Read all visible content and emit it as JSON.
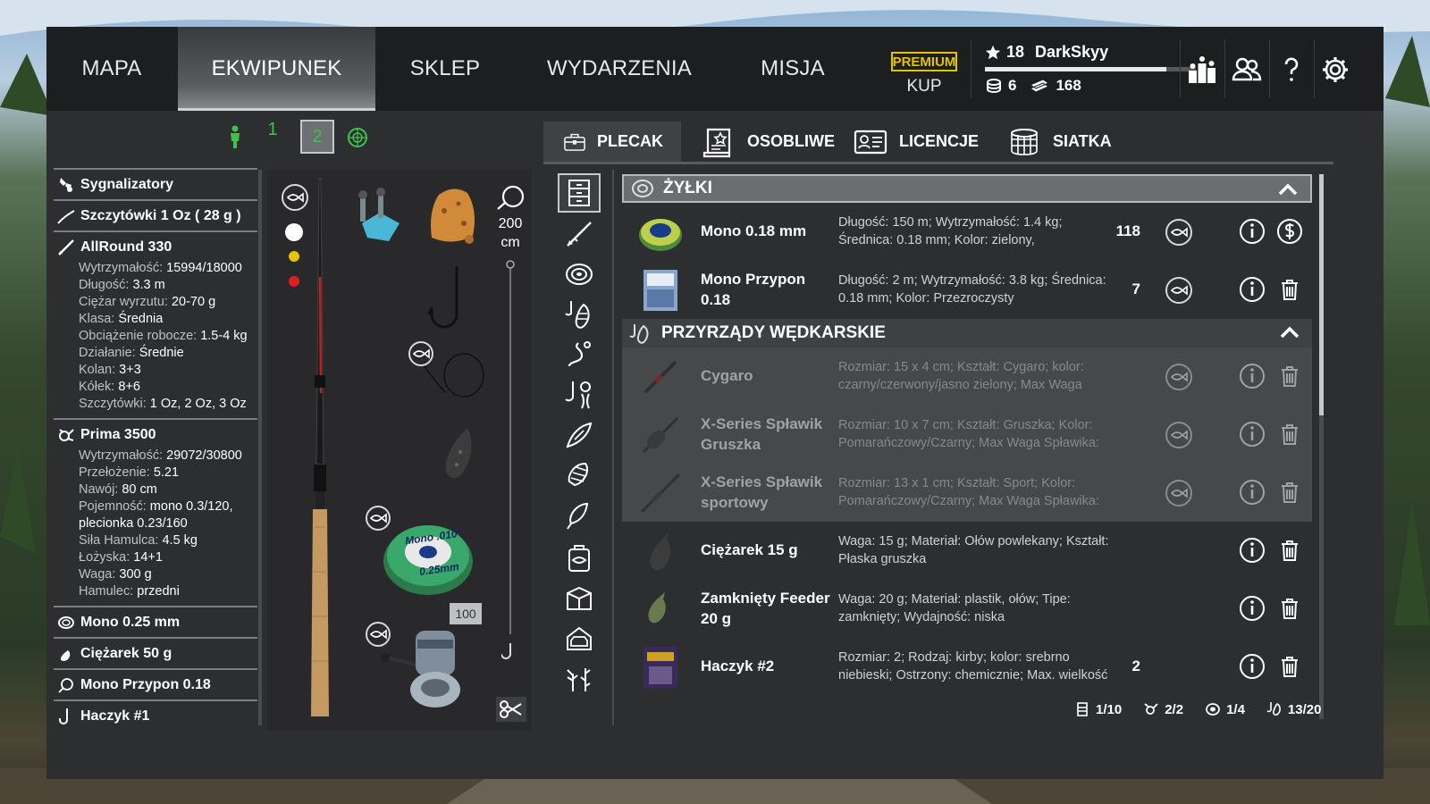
{
  "nav": {
    "tabs": [
      {
        "label": "MAPA"
      },
      {
        "label": "EKWIPUNEK"
      },
      {
        "label": "SKLEP"
      },
      {
        "label": "WYDARZENIA"
      },
      {
        "label": "MISJA"
      }
    ],
    "active": "EKWIPUNEK"
  },
  "premium": {
    "badge": "PREMIUM",
    "buy": "KUP"
  },
  "player": {
    "level": "18",
    "name": "DarkSkyy",
    "xp_fraction": 0.86,
    "coins": "6",
    "bills": "168"
  },
  "presets": {
    "p1": "1",
    "p2": "2"
  },
  "left": {
    "sygnalizatory": "Sygnalizatory",
    "szczytowki": "Szczytówki 1 Oz ( 28 g )",
    "rod": {
      "name": "AllRound 330",
      "stats": [
        {
          "label": "Wytrzymałość:",
          "value": "15994/18000"
        },
        {
          "label": "Długość:",
          "value": "3.3 m"
        },
        {
          "label": "Ciężar wyrzutu:",
          "value": "20-70 g"
        },
        {
          "label": "Klasa:",
          "value": "Średnia"
        },
        {
          "label": "Obciążenie robocze:",
          "value": "1.5-4 kg"
        },
        {
          "label": "Działanie:",
          "value": "Średnie"
        },
        {
          "label": "Kolan:",
          "value": "3+3"
        },
        {
          "label": "Kółek:",
          "value": "8+6"
        },
        {
          "label": "Szczytówki:",
          "value": "1 Oz, 2 Oz, 3 Oz"
        }
      ]
    },
    "reel": {
      "name": "Prima 3500",
      "stats": [
        {
          "label": "Wytrzymałość:",
          "value": "29072/30800"
        },
        {
          "label": "Przełożenie:",
          "value": "5.21"
        },
        {
          "label": "Nawój:",
          "value": "80 cm"
        },
        {
          "label": "Pojemność:",
          "value": "mono 0.3/120,"
        },
        {
          "label": "",
          "value": "plecionka 0.23/160"
        },
        {
          "label": "Siła Hamulca:",
          "value": "4.5 kg"
        },
        {
          "label": "Łożyska:",
          "value": "14+1"
        },
        {
          "label": "Waga:",
          "value": "300 g"
        },
        {
          "label": "Hamulec:",
          "value": "przedni"
        }
      ]
    },
    "line": "Mono 0.25 mm",
    "sinker": "Ciężarek 50 g",
    "leader": "Mono Przypon 0.18",
    "hook": "Haczyk #1"
  },
  "rig": {
    "leader_length": "200",
    "leader_unit": "cm",
    "spool_label_top": "Mono",
    ".010": ".010\"",
    "spool_size": "0.25mm",
    "spool_qty": "100",
    "reel_brand": "Prima"
  },
  "tabs": [
    {
      "label": "PLECAK"
    },
    {
      "label": "OSOBLIWE"
    },
    {
      "label": "LICENCJE"
    },
    {
      "label": "SIATKA"
    }
  ],
  "groups": {
    "lines": "ŻYŁKI",
    "tackle": "PRZYRZĄDY WĘDKARSKIE"
  },
  "items": [
    {
      "name": "Mono 0.18 mm",
      "desc": "Długość: 150 m; Wytrzymałość: 1.4 kg; Średnica: 0.18 mm; Kolor: zielony,",
      "qty": "118"
    },
    {
      "name": "Mono Przypon 0.18",
      "desc": "Długość: 2 m; Wytrzymałość: 3.8 kg; Średnica: 0.18 mm; Kolor: Przezroczysty",
      "qty": "7"
    },
    {
      "name": "Cygaro",
      "desc": "Rozmiar: 15  x 4 cm; Kształt: Cygaro; kolor: czarny/czerwony/jasno zielony; Max Waga",
      "qty": ""
    },
    {
      "name": "X-Series Spławik Gruszka",
      "desc": "Rozmiar: 10 x 7 cm; Kształt: Gruszka; Kolor: Pomarańczowy/Czarny; Max Waga Spławika:",
      "qty": ""
    },
    {
      "name": "X-Series Spławik sportowy",
      "desc": "Rozmiar: 13 x 1 cm; Kształt: Sport; Kolor: Pomarańczowy/Czarny; Max Waga Spławika:",
      "qty": ""
    },
    {
      "name": "Ciężarek 15 g",
      "desc": "Waga: 15 g; Materiał: Ołów powlekany; Kształt: Płaska gruszka",
      "qty": ""
    },
    {
      "name": "Zamknięty Feeder 20 g",
      "desc": "Waga: 20 g; Materiał: plastik, ołów; Tipe: zamknięty; Wydajność: niska",
      "qty": ""
    },
    {
      "name": "Haczyk #2",
      "desc": "Rozmiar: 2; Rodzaj: kirby; kolor: srebrno niebieski; Ostrzony: chemicznie; Max. wielkość",
      "qty": "2"
    }
  ],
  "footer": {
    "box": "1/10",
    "reels": "2/2",
    "lines": "1/4",
    "tackle": "13/20"
  },
  "colors": {
    "accent_green": "#3ec34e",
    "premium": "#e4c400",
    "panel": "#2d2e30"
  }
}
